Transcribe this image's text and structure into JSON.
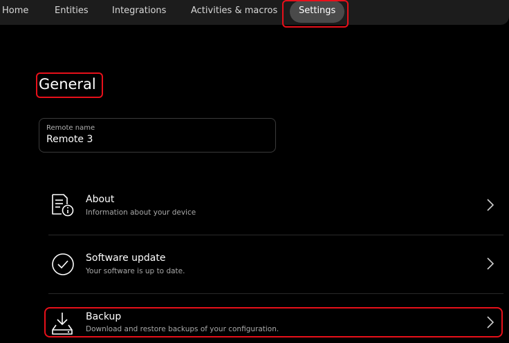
{
  "nav": {
    "tabs": [
      {
        "label": "Home"
      },
      {
        "label": "Entities"
      },
      {
        "label": "Integrations"
      },
      {
        "label": "Activities & macros"
      },
      {
        "label": "Settings",
        "active": true
      }
    ]
  },
  "page": {
    "title": "General"
  },
  "remote_name": {
    "label": "Remote name",
    "value": "Remote 3"
  },
  "settings": [
    {
      "title": "About",
      "subtitle": "Information about your device",
      "icon": "document-info-icon"
    },
    {
      "title": "Software update",
      "subtitle": "Your software is up to date.",
      "icon": "check-circle-icon"
    },
    {
      "title": "Backup",
      "subtitle": "Download and restore backups of your configuration.",
      "icon": "download-drive-icon"
    }
  ],
  "colors": {
    "background": "#000000",
    "nav": "#1c1c1c",
    "active_tab": "#4a4a4a",
    "highlight": "#e8101a"
  }
}
